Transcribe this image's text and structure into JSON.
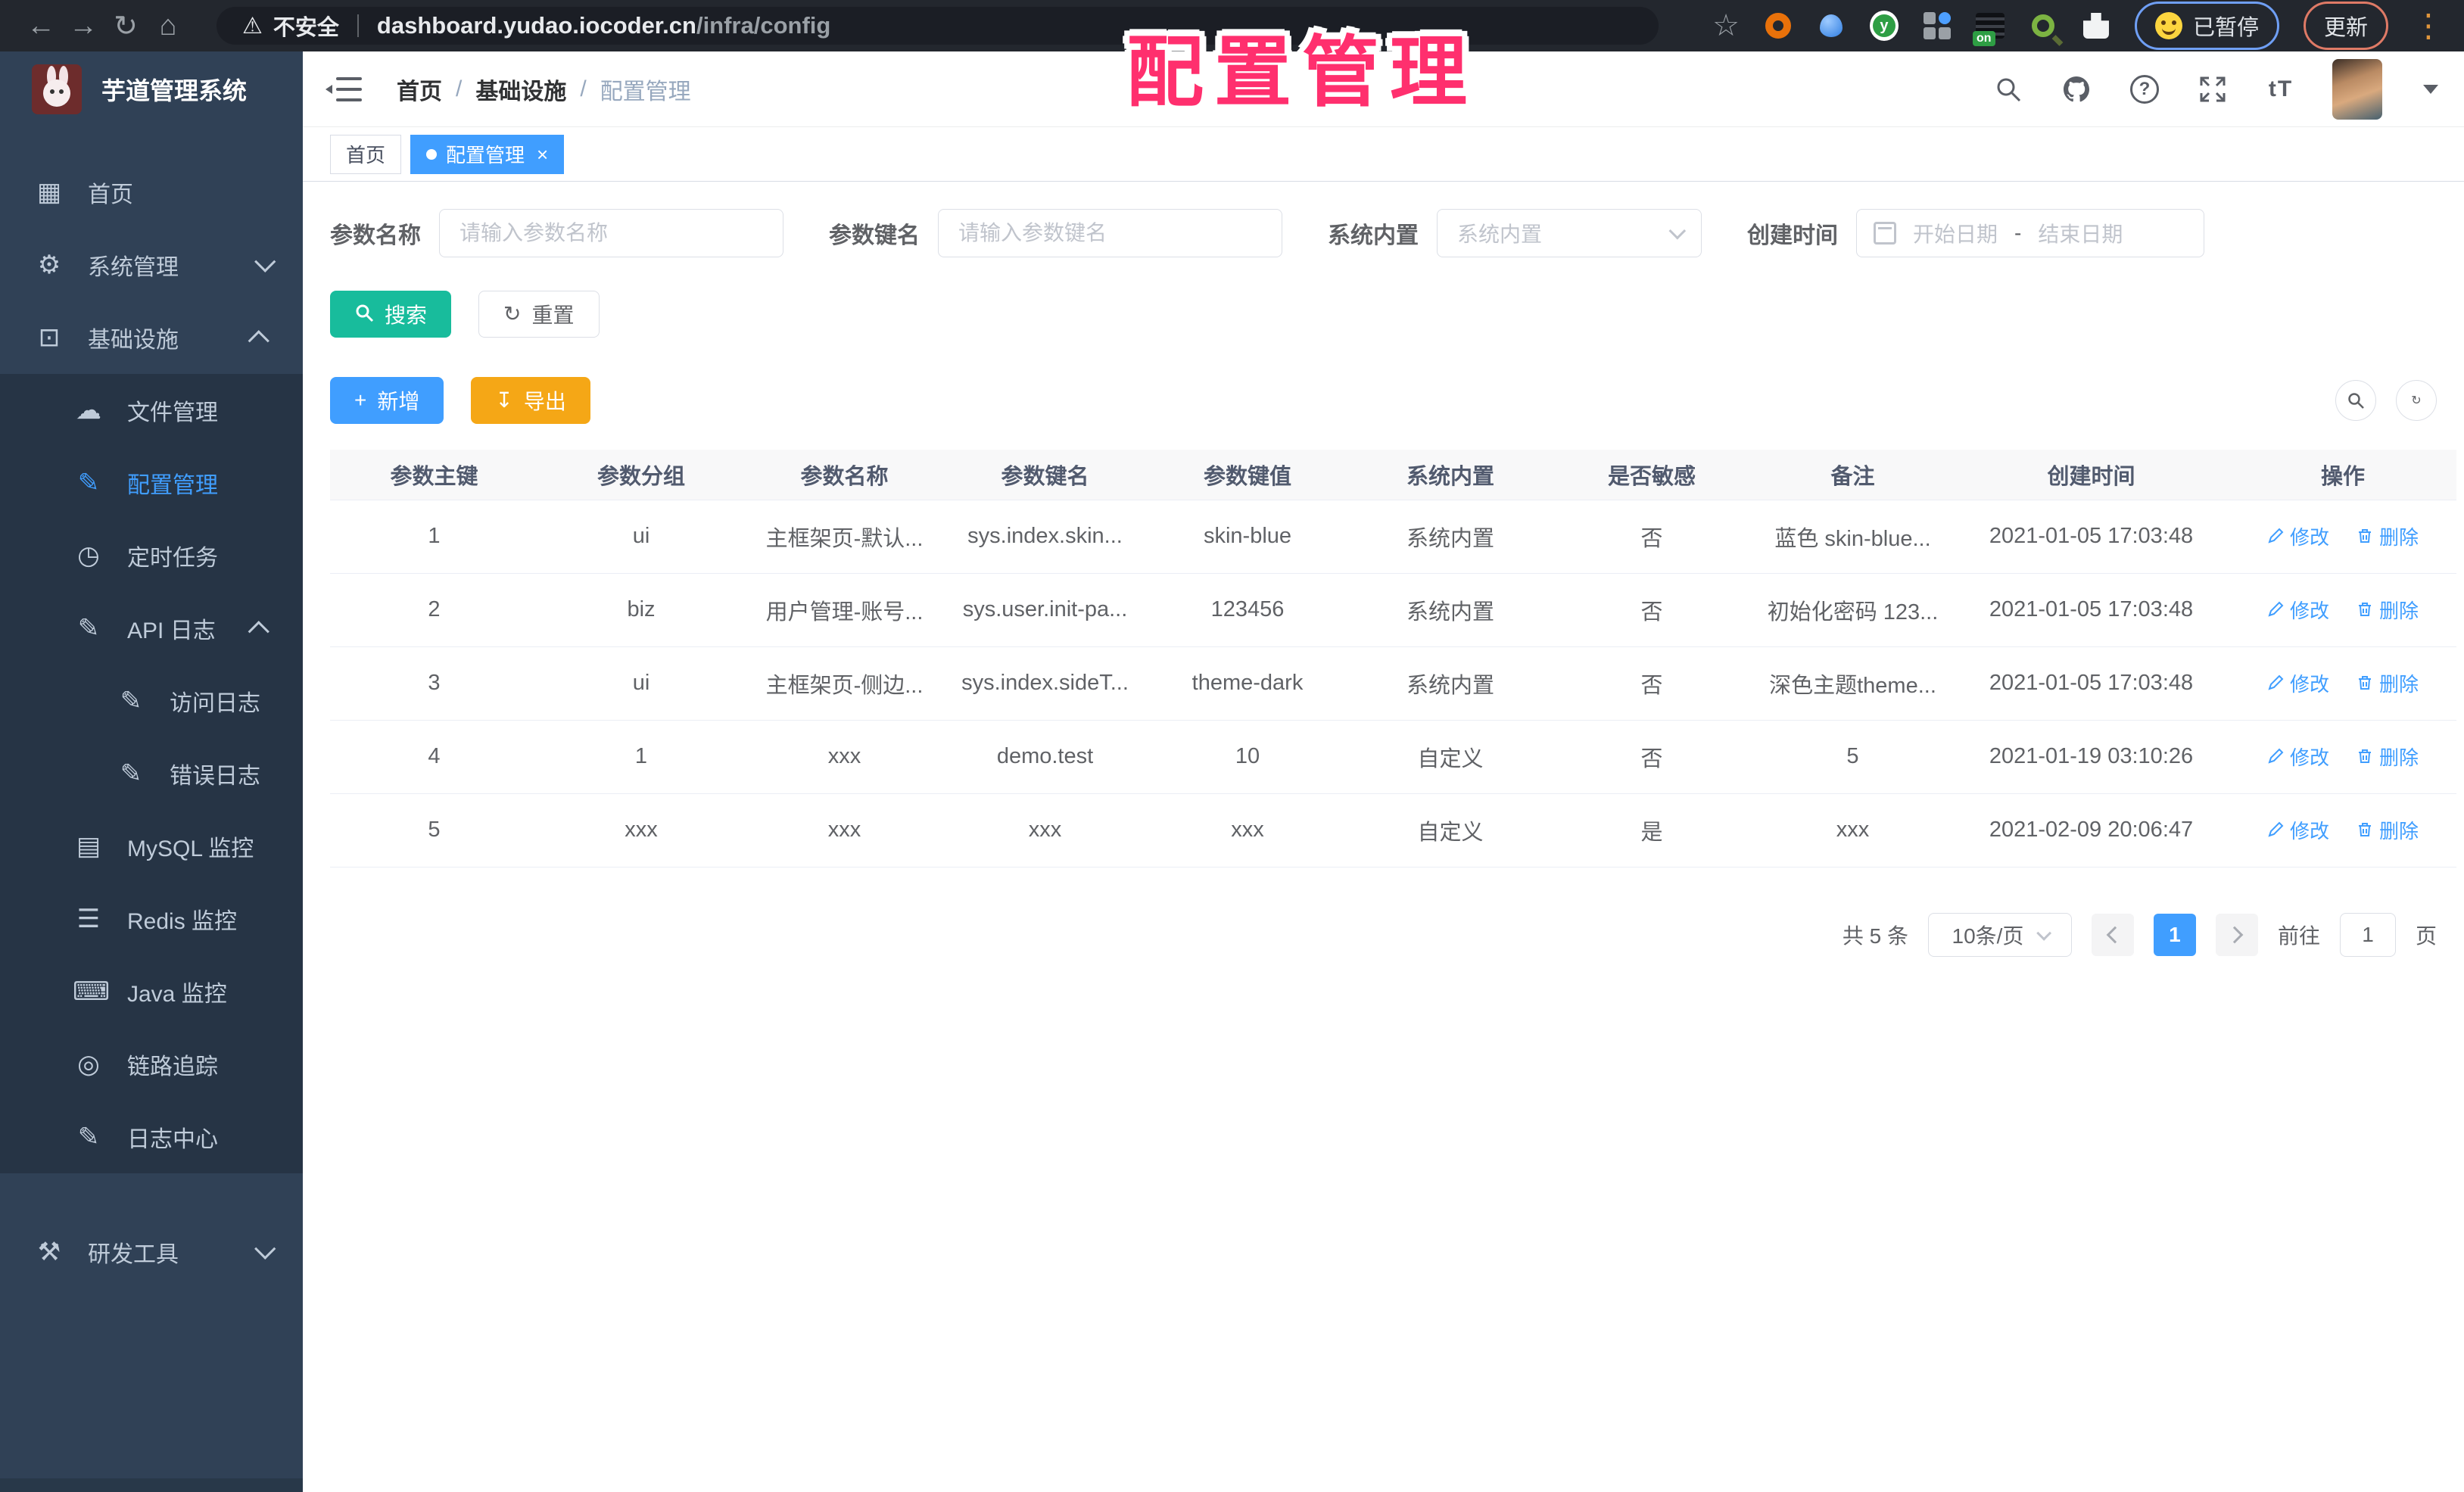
{
  "browser": {
    "security_label": "不安全",
    "url_host": "dashboard.yudao.iocoder.cn",
    "url_path": "/infra/config",
    "extension_on_badge": "on",
    "paused_label": "已暂停",
    "update_label": "更新"
  },
  "overlay": {
    "title": "配置管理",
    "color": "#ff2f6e"
  },
  "sidebar": {
    "app_title": "芋道管理系统",
    "colors": {
      "background": "#304156",
      "submenu_background": "#263445",
      "active": "#409eff"
    },
    "items": [
      {
        "label": "首页"
      },
      {
        "label": "系统管理"
      },
      {
        "label": "基础设施"
      },
      {
        "label": "文件管理"
      },
      {
        "label": "配置管理"
      },
      {
        "label": "定时任务"
      },
      {
        "label": "API 日志"
      },
      {
        "label": "访问日志"
      },
      {
        "label": "错误日志"
      },
      {
        "label": "MySQL 监控"
      },
      {
        "label": "Redis 监控"
      },
      {
        "label": "Java 监控"
      },
      {
        "label": "链路追踪"
      },
      {
        "label": "日志中心"
      },
      {
        "label": "研发工具"
      }
    ]
  },
  "header": {
    "breadcrumb": [
      "首页",
      "基础设施",
      "配置管理"
    ],
    "breadcrumb_separator": "/",
    "fontsize_icon_text": "tT"
  },
  "tabs": [
    {
      "label": "首页",
      "active": false
    },
    {
      "label": "配置管理",
      "active": true
    }
  ],
  "filters": {
    "name_label": "参数名称",
    "name_placeholder": "请输入参数名称",
    "key_label": "参数键名",
    "key_placeholder": "请输入参数键名",
    "builtin_label": "系统内置",
    "builtin_placeholder": "系统内置",
    "date_label": "创建时间",
    "date_start_placeholder": "开始日期",
    "date_separator": "-",
    "date_end_placeholder": "结束日期",
    "search_label": "搜索",
    "reset_label": "重置"
  },
  "toolbar": {
    "add_label": "新增",
    "export_label": "导出"
  },
  "table": {
    "columns": [
      "参数主键",
      "参数分组",
      "参数名称",
      "参数键名",
      "参数键值",
      "系统内置",
      "是否敏感",
      "备注",
      "创建时间",
      "操作"
    ],
    "edit_label": "修改",
    "delete_label": "删除",
    "rows": [
      {
        "id": "1",
        "group": "ui",
        "name": "主框架页-默认...",
        "key": "sys.index.skin...",
        "value": "skin-blue",
        "builtin": "系统内置",
        "sensitive": "否",
        "remark": "蓝色 skin-blue...",
        "created": "2021-01-05 17:03:48"
      },
      {
        "id": "2",
        "group": "biz",
        "name": "用户管理-账号...",
        "key": "sys.user.init-pa...",
        "value": "123456",
        "builtin": "系统内置",
        "sensitive": "否",
        "remark": "初始化密码 123...",
        "created": "2021-01-05 17:03:48"
      },
      {
        "id": "3",
        "group": "ui",
        "name": "主框架页-侧边...",
        "key": "sys.index.sideT...",
        "value": "theme-dark",
        "builtin": "系统内置",
        "sensitive": "否",
        "remark": "深色主题theme...",
        "created": "2021-01-05 17:03:48"
      },
      {
        "id": "4",
        "group": "1",
        "name": "xxx",
        "key": "demo.test",
        "value": "10",
        "builtin": "自定义",
        "sensitive": "否",
        "remark": "5",
        "created": "2021-01-19 03:10:26"
      },
      {
        "id": "5",
        "group": "xxx",
        "name": "xxx",
        "key": "xxx",
        "value": "xxx",
        "builtin": "自定义",
        "sensitive": "是",
        "remark": "xxx",
        "created": "2021-02-09 20:06:47"
      }
    ]
  },
  "pagination": {
    "total_text": "共 5 条",
    "page_size": "10条/页",
    "current_page": "1",
    "goto_label": "前往",
    "goto_value": "1",
    "page_unit": "页"
  }
}
